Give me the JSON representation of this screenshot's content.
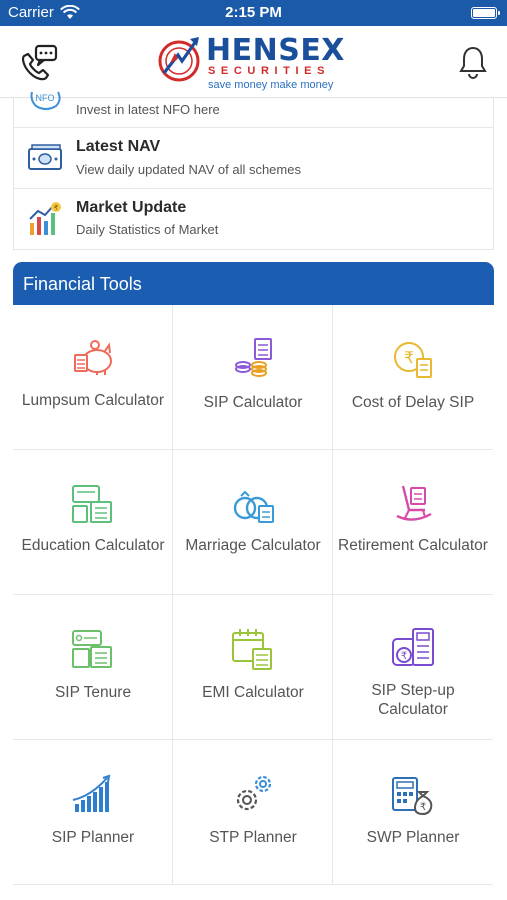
{
  "status_bar": {
    "carrier": "Carrier",
    "time": "2:15 PM"
  },
  "header": {
    "brand": "HENSEX",
    "brand_sub": "SECURITIES",
    "tagline": "save money make money"
  },
  "list": [
    {
      "title": "",
      "subtitle": "Invest in latest NFO here",
      "icon": "nfo-icon",
      "icon_text": "NFO"
    },
    {
      "title": "Latest NAV",
      "subtitle": "View daily updated NAV of all schemes",
      "icon": "money-icon"
    },
    {
      "title": "Market Update",
      "subtitle": "Daily Statistics of Market",
      "icon": "market-chart-icon"
    }
  ],
  "financial_tools": {
    "title": "Financial Tools",
    "tools": [
      {
        "label": "Lumpsum Calculator",
        "icon": "piggy-bank-icon",
        "color": "#f06a5a"
      },
      {
        "label": "SIP Calculator",
        "icon": "coin-stack-icon",
        "color": "#8a5ad8"
      },
      {
        "label": "Cost of Delay SIP",
        "icon": "rupee-coin-calculator-icon",
        "color": "#e8b830"
      },
      {
        "label": "Education Calculator",
        "icon": "education-calculator-icon",
        "color": "#5cc07a"
      },
      {
        "label": "Marriage Calculator",
        "icon": "rings-icon",
        "color": "#3a9ad8"
      },
      {
        "label": "Retirement Calculator",
        "icon": "rocking-chair-icon",
        "color": "#d84aa8"
      },
      {
        "label": "SIP Tenure",
        "icon": "tenure-calculator-icon",
        "color": "#6cc06a"
      },
      {
        "label": "EMI Calculator",
        "icon": "calendar-calculator-icon",
        "color": "#9ac43a"
      },
      {
        "label": "SIP Step-up Calculator",
        "icon": "wallet-calculator-icon",
        "color": "#7a4ad0"
      },
      {
        "label": "SIP Planner",
        "icon": "growth-bars-icon",
        "color": "#2f7fd0"
      },
      {
        "label": "STP Planner",
        "icon": "gears-icon",
        "color": "#3a8fd8"
      },
      {
        "label": "SWP Planner",
        "icon": "rupee-bag-calculator-icon",
        "color": "#2f6fb8"
      }
    ]
  }
}
